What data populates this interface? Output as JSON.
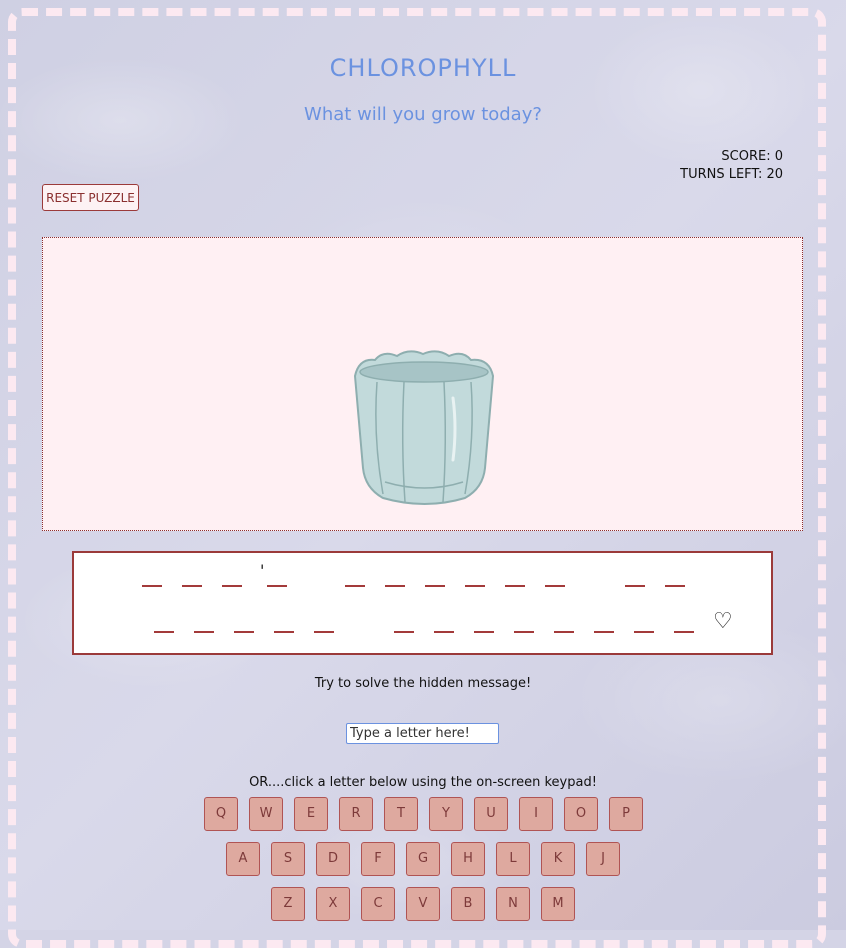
{
  "header": {
    "title": "CHLOROPHYLL",
    "subtitle": "What will you grow today?"
  },
  "score": {
    "score_text": "SCORE: 0",
    "turns_text": "TURNS LEFT: 20"
  },
  "reset_button": {
    "label": "RESET PUZZLE"
  },
  "phrase": {
    "line1_words": [
      4,
      6,
      2
    ],
    "line1_apostrophe_after_letter": 3,
    "line2_words": [
      5,
      8
    ],
    "trailing_symbol": "♡"
  },
  "instruction": "Try to solve the hidden message!",
  "input": {
    "placeholder": "Type a letter here!"
  },
  "keypad_hint": "OR....click a letter below using the on-screen keypad!",
  "keypad": {
    "row1": [
      "Q",
      "W",
      "E",
      "R",
      "T",
      "Y",
      "U",
      "I",
      "O",
      "P"
    ],
    "row2": [
      "A",
      "S",
      "D",
      "F",
      "G",
      "H",
      "L",
      "K",
      "J"
    ],
    "row3": [
      "Z",
      "X",
      "C",
      "V",
      "B",
      "N",
      "M"
    ]
  },
  "colors": {
    "accent": "#6b92e0",
    "border_red": "#9b3a3a",
    "key_fill": "#dea99f",
    "stage_fill": "#fff0f3",
    "frame_dash": "#fce9f1"
  }
}
